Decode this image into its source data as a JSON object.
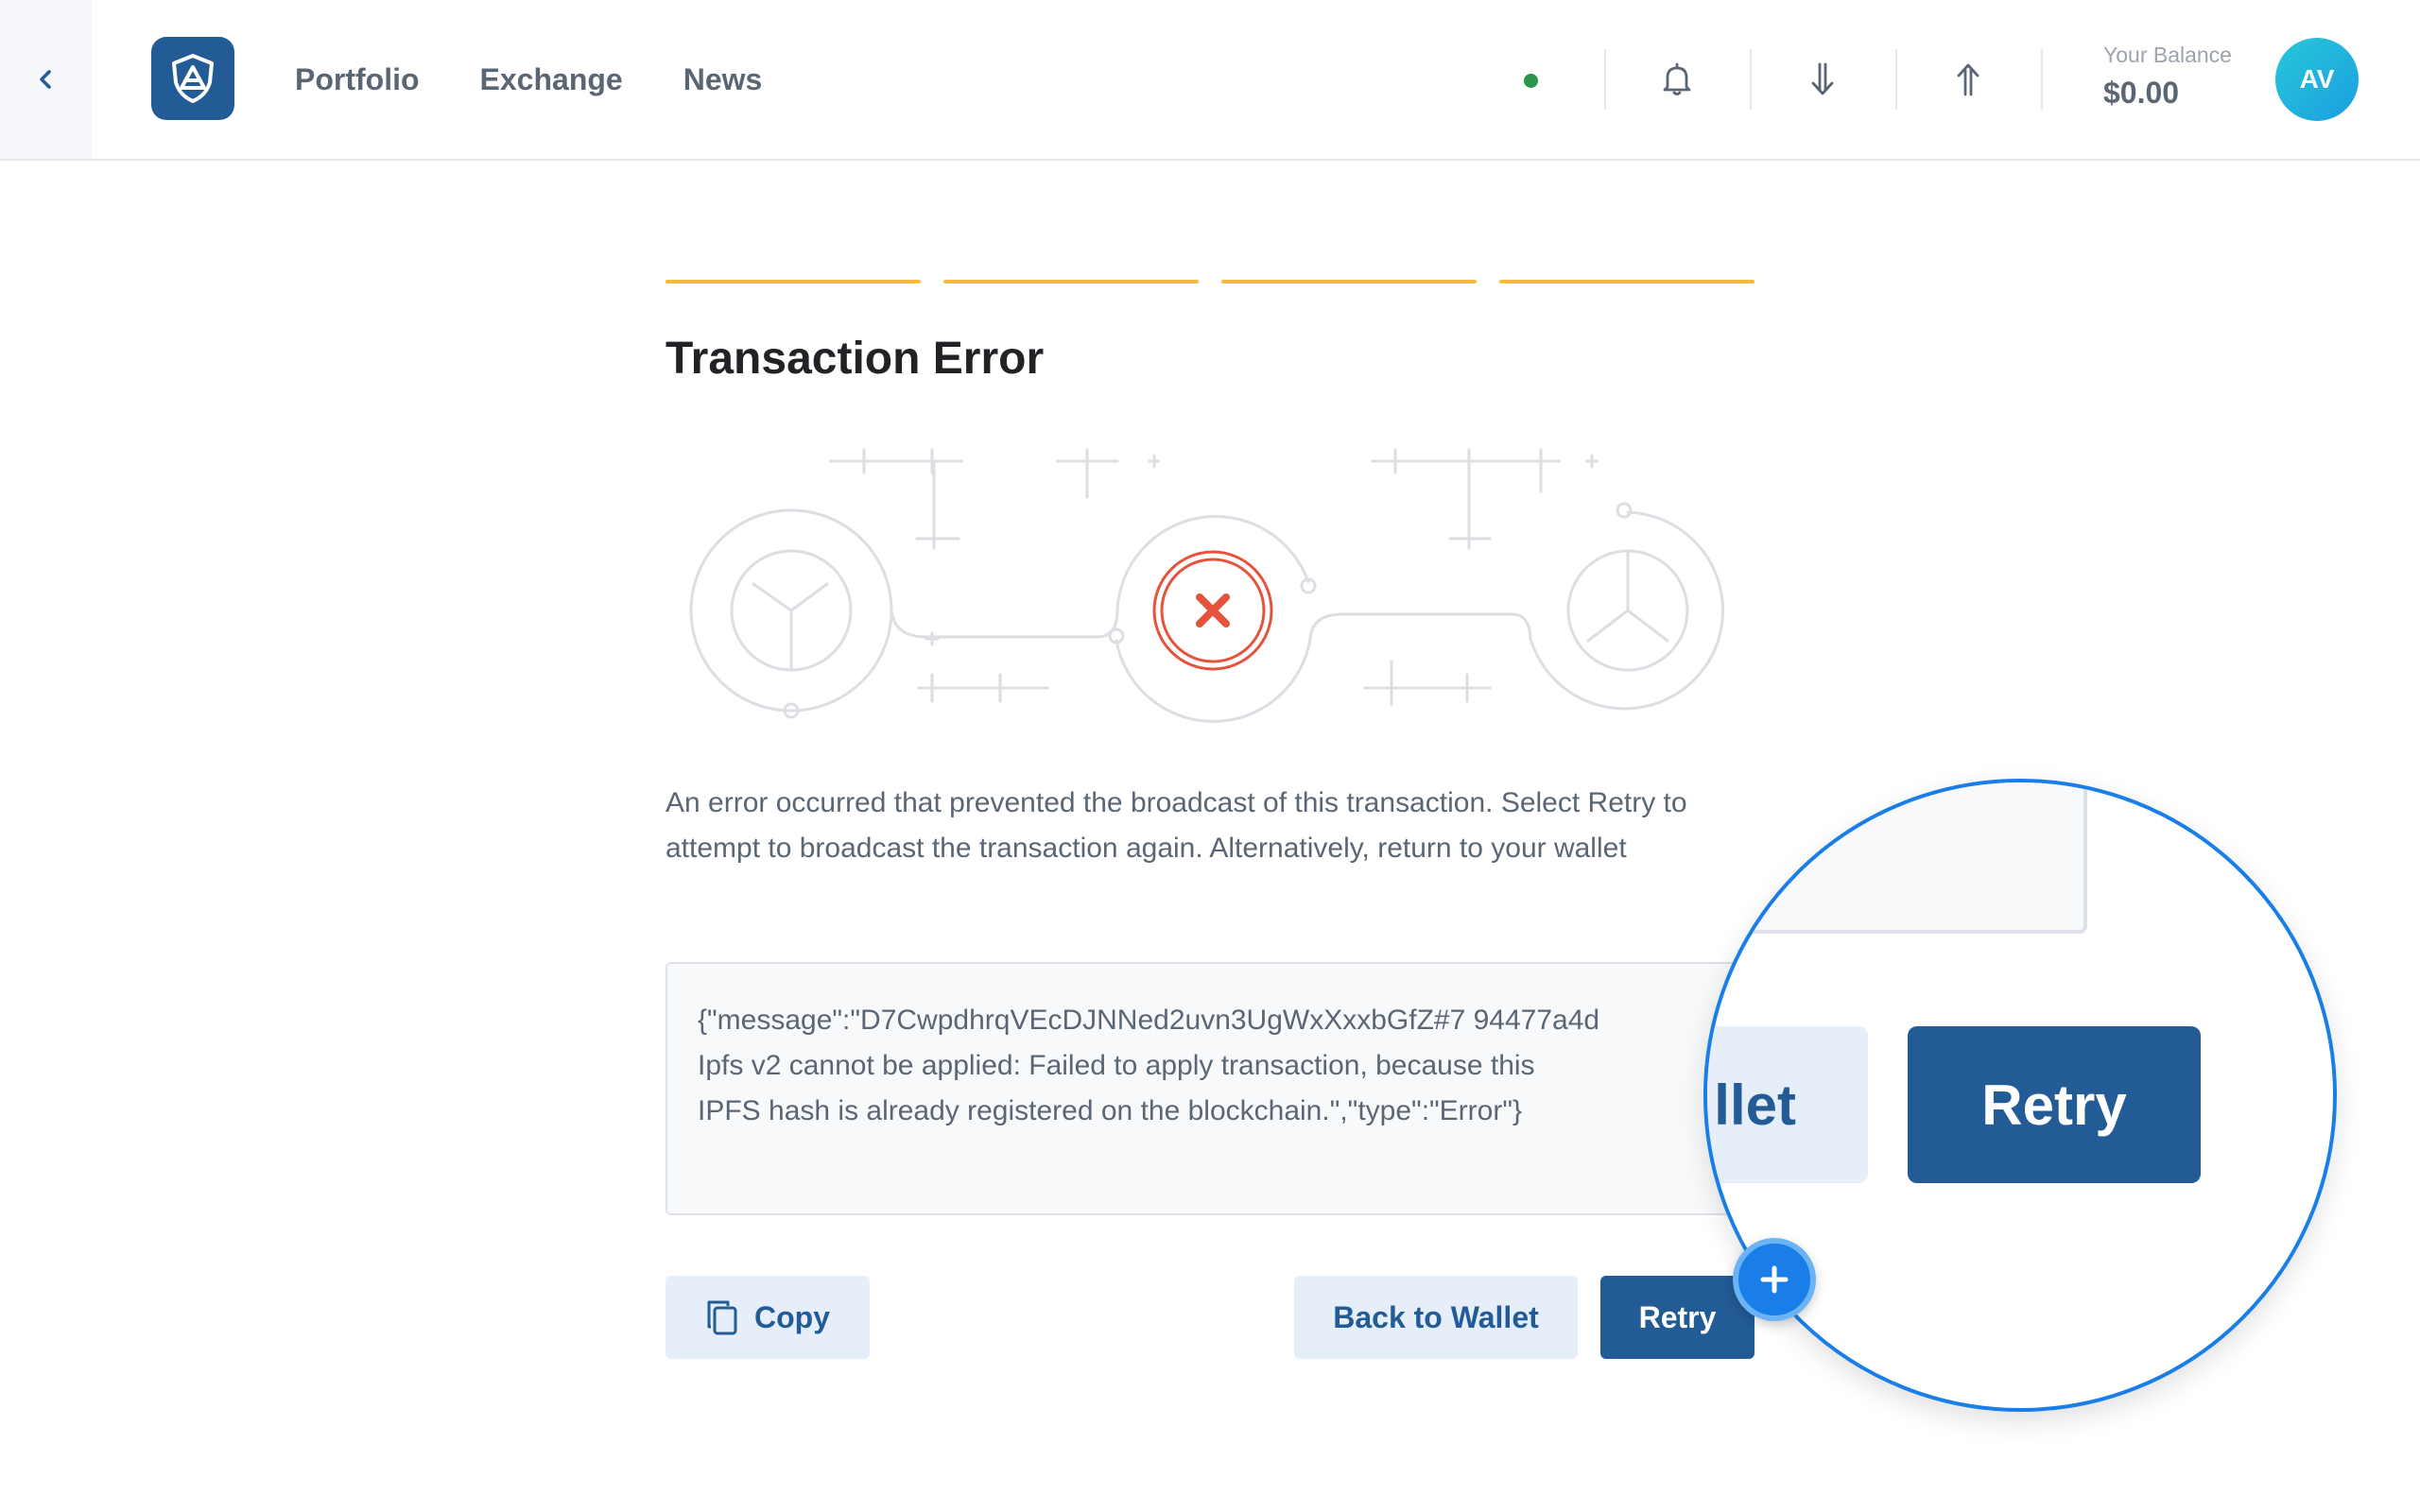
{
  "header": {
    "nav": [
      "Portfolio",
      "Exchange",
      "News"
    ],
    "balance_label": "Your Balance",
    "balance_value": "$0.00",
    "avatar_initials": "AV",
    "status_color": "#289548"
  },
  "icons": {
    "back": "chevron-left-icon",
    "logo": "ark-logo",
    "notifications": "bell-icon",
    "receive": "arrow-down-icon",
    "send": "arrow-up-icon",
    "copy": "copy-icon",
    "error": "error-x-icon",
    "plus": "plus-icon"
  },
  "steps": {
    "count": 4,
    "color": "#f6ba3f"
  },
  "main": {
    "title": "Transaction Error",
    "description": "An error occurred that prevented the broadcast of this transaction. Select Retry to attempt to broadcast the transaction again. Alternatively, return to your wallet",
    "error_message": "{\"message\":\"D7CwpdhrqVEcDJNNed2uvn3UgWxXxxbGfZ#7 94477a4d\nIpfs v2 cannot be applied: Failed to apply transaction, because this\nIPFS hash is already registered on the blockchain.\",\"type\":\"Error\"}"
  },
  "buttons": {
    "copy": "Copy",
    "back_to_wallet": "Back to Wallet",
    "retry": "Retry"
  },
  "magnifier": {
    "wallet_fragment": "llet",
    "retry": "Retry"
  },
  "colors": {
    "primary": "#235b96",
    "primary_light": "#e6eef9",
    "danger": "#e5533d",
    "magnifier_border": "#1a7ee8"
  }
}
